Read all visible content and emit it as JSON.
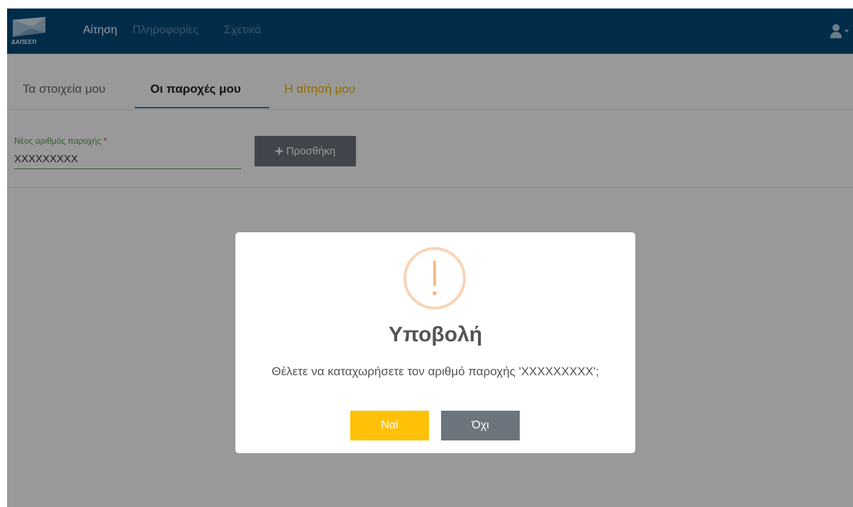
{
  "navbar": {
    "logo_text": "ΔΑΠΕΕΠ",
    "links": [
      {
        "label": "Αίτηση"
      },
      {
        "label": "Πληροφορίες"
      },
      {
        "label": "Σχετικά"
      }
    ],
    "user_icon": "user-icon",
    "caret_icon": "caret-down-icon"
  },
  "tabs": [
    {
      "label": "Τα στοιχεία μου"
    },
    {
      "label": "Οι παροχές μου"
    },
    {
      "label": "Η αίτησή μου"
    }
  ],
  "form": {
    "label": "Νέος αριθμός παροχής",
    "required_mark": "*",
    "value": "XXXXXXXXX",
    "add_icon": "plus-icon",
    "add_label": "Προσθήκη"
  },
  "modal": {
    "icon": "warning-icon",
    "title": "Υποβολή",
    "text": "Θέλετε να καταχωρήσετε τον αριθμό παροχής 'XXXXXXXXX';",
    "yes_label": "Ναί",
    "no_label": "Όχι"
  },
  "colors": {
    "navbar": "#004a7c",
    "accent_orange": "#f0b400",
    "yes_button": "#ffc107",
    "no_button": "#6c757d",
    "warning_icon": "#f8bb86"
  }
}
